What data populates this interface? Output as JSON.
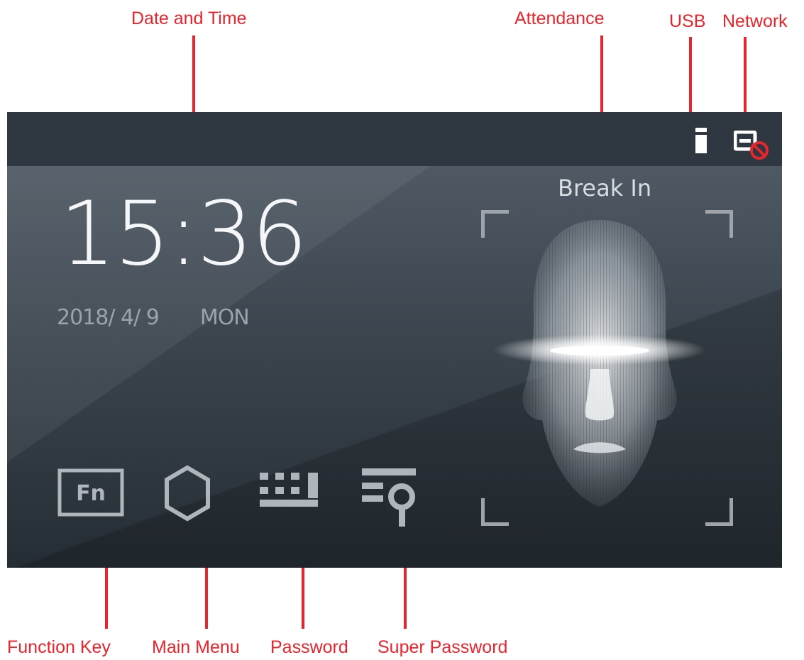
{
  "annotations": {
    "date_time": "Date and Time",
    "attendance": "Attendance",
    "usb": "USB",
    "network": "Network",
    "function_key": "Function Key",
    "main_menu": "Main Menu",
    "password": "Password",
    "super_password": "Super Password"
  },
  "screen": {
    "time": "15:36",
    "date": "2018/ 4/ 9",
    "weekday": "MON",
    "attendance_status": "Break In",
    "fn_button_label": "Fn"
  },
  "icons": {
    "usb": "usb-drive-icon",
    "network": "network-disconnected-icon",
    "function_key": "fn-key-icon",
    "main_menu": "hexagon-menu-icon",
    "password": "keypad-icon",
    "super_password": "super-password-icon"
  },
  "colors": {
    "callout": "#e8242c",
    "screen_top": "#55606b",
    "screen_bottom": "#252d34",
    "status_bar": "#2f3840",
    "icon_gray": "#aeb5bb",
    "network_off": "#e8242c"
  }
}
